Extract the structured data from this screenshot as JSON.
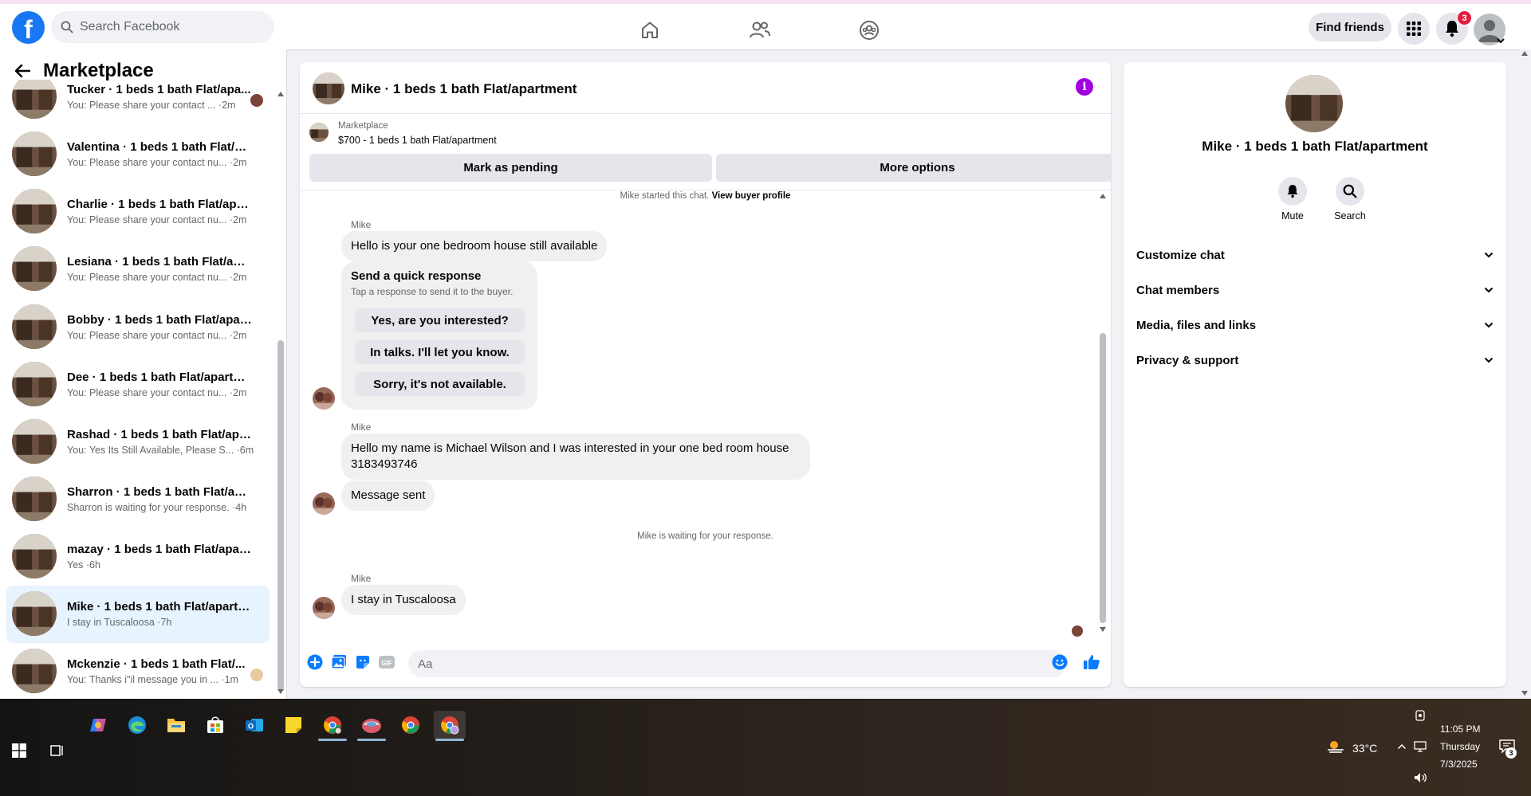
{
  "topbar": {
    "logo": "f",
    "search_placeholder": "Search Facebook",
    "find_friends_label": "Find friends",
    "notification_count": "3"
  },
  "sidebar": {
    "title": "Marketplace",
    "conversations": [
      {
        "name": "Tucker · 1 beds 1 bath Flat/apa...",
        "snippet": "You: Please share your contact ... ·2m"
      },
      {
        "name": "Valentina · 1 beds 1 bath Flat/ap...",
        "snippet": "You: Please share your contact nu... ·2m"
      },
      {
        "name": "Charlie · 1 beds 1 bath Flat/apart...",
        "snippet": "You: Please share your contact nu... ·2m"
      },
      {
        "name": "Lesiana · 1 beds 1 bath Flat/apart...",
        "snippet": "You: Please share your contact nu... ·2m"
      },
      {
        "name": "Bobby · 1 beds 1 bath Flat/apart...",
        "snippet": "You: Please share your contact nu... ·2m"
      },
      {
        "name": "Dee · 1 beds 1 bath Flat/apartment",
        "snippet": "You: Please share your contact nu... ·2m"
      },
      {
        "name": "Rashad · 1 beds 1 bath Flat/apart...",
        "snippet": "You: Yes Its Still Available, Please S... ·6m"
      },
      {
        "name": "Sharron · 1 beds 1 bath Flat/apar...",
        "snippet": "Sharron is waiting for your response. ·4h"
      },
      {
        "name": "mazay · 1 beds 1 bath Flat/apart...",
        "snippet": "Yes ·6h"
      },
      {
        "name": "Mike · 1 beds 1 bath Flat/apartm...",
        "snippet": "I stay in Tuscaloosa ·7h"
      },
      {
        "name": "Mckenzie · 1 beds 1 bath Flat/...",
        "snippet": "You: Thanks i\"il message you in ... ·1m"
      }
    ]
  },
  "chat": {
    "title": "Mike · 1 beds 1 bath Flat/apartment",
    "marketplace_label": "Marketplace",
    "listing": "$700 - 1 beds 1 bath Flat/apartment",
    "mark_pending_label": "Mark as pending",
    "more_options_label": "More options",
    "started_text": "Mike started this chat.",
    "view_buyer_label": "View buyer profile",
    "sender_name": "Mike",
    "msg1": "Hello is your one bedroom house still available",
    "quick_title": "Send a quick response",
    "quick_sub": "Tap a response to send it to the buyer.",
    "quick_options": [
      "Yes, are you interested?",
      "In talks. I'll let you know.",
      "Sorry, it's not available."
    ],
    "msg2": "Hello my name is Michael Wilson and I was interested in your one bed room house 3183493746",
    "msg3": "Message sent",
    "waiting_text": "Mike is waiting for your response.",
    "msg4": "I stay in Tuscaloosa",
    "composer_placeholder": "Aa"
  },
  "info_panel": {
    "name": "Mike · 1 beds 1 bath Flat/apartment",
    "mute_label": "Mute",
    "search_label": "Search",
    "sections": [
      "Customize chat",
      "Chat members",
      "Media, files and links",
      "Privacy & support"
    ]
  },
  "taskbar": {
    "temperature": "33°C",
    "time": "11:05 PM",
    "day": "Thursday",
    "date": "7/3/2025",
    "notification_count": "3"
  },
  "colors": {
    "brand": "#1877f2",
    "info_purple": "#a000e0",
    "notification_red": "#e41e3f",
    "active_row": "#e7f3ff"
  }
}
